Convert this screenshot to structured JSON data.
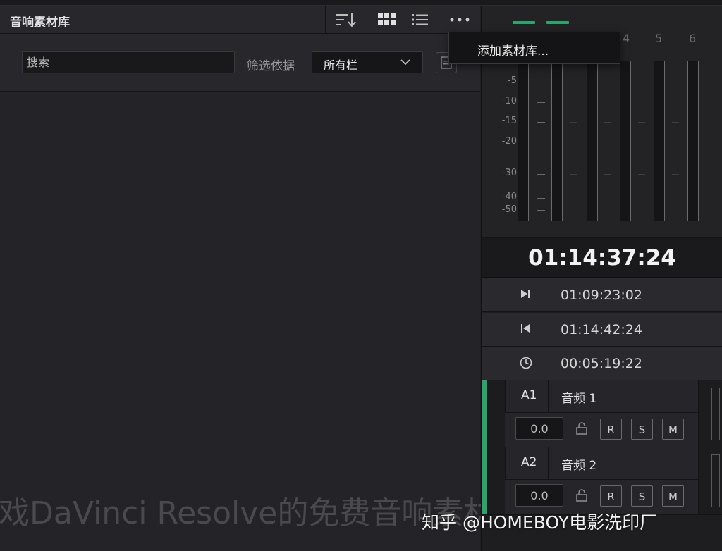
{
  "panel": {
    "title": "音响素材库",
    "search_placeholder": "搜索",
    "filter_label": "筛选依据",
    "filter_value": "所有栏"
  },
  "menu": {
    "add_library": "添加素材库..."
  },
  "meters": {
    "channels": [
      "4",
      "5",
      "6"
    ],
    "db_labels": [
      "-5",
      "-10",
      "-15",
      "-20",
      "-30",
      "-40",
      "-50"
    ]
  },
  "timecode": {
    "current": "01:14:37:24",
    "in_point": "01:09:23:02",
    "out_point": "01:14:42:24",
    "duration": "00:05:19:22"
  },
  "tracks": [
    {
      "id": "A1",
      "name": "音频 1",
      "volume": "0.0",
      "r": "R",
      "s": "S",
      "m": "M"
    },
    {
      "id": "A2",
      "name": "音频 2",
      "volume": "0.0",
      "r": "R",
      "s": "S",
      "m": "M"
    }
  ],
  "overlay": {
    "subtitle": "戏DaVinci Resolve的免费音响素材",
    "watermark": "知乎 @HOMEBOY电影洗印厂"
  },
  "colors": {
    "accent_green": "#2aa66a",
    "background": "#1f1f23"
  }
}
